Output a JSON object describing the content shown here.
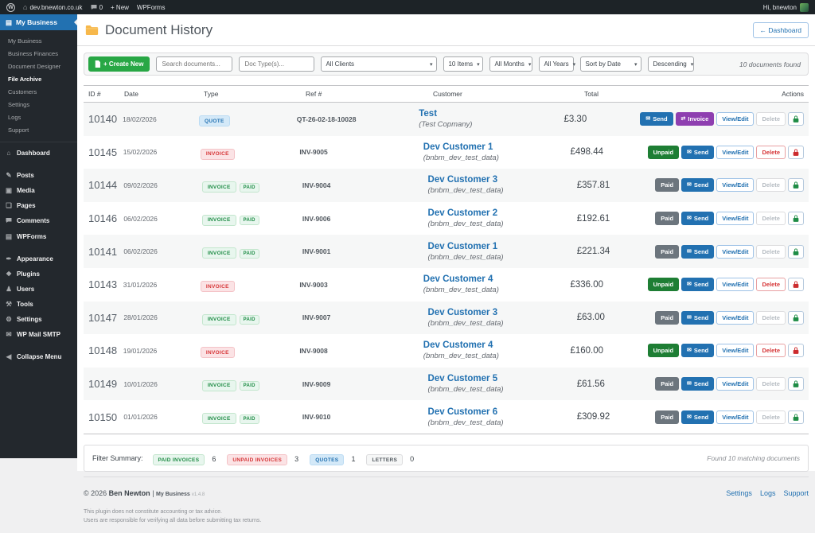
{
  "admin_bar": {
    "site": "dev.bnewton.co.uk",
    "comment_count": "0",
    "new_label": "+ New",
    "wpforms_label": "WPForms",
    "greeting": "Hi, bnewton"
  },
  "sidebar": {
    "top_label": "My Business",
    "submenu": [
      "My Business",
      "Business Finances",
      "Document Designer",
      "File Archive",
      "Customers",
      "Settings",
      "Logs",
      "Support"
    ],
    "active_submenu": "File Archive",
    "menu": [
      {
        "label": "Dashboard",
        "glyph": "⌂",
        "icon": "dashboard-icon",
        "gap": false
      },
      {
        "label": "Posts",
        "glyph": "✎",
        "icon": "posts-icon",
        "gap": true
      },
      {
        "label": "Media",
        "glyph": "▣",
        "icon": "media-icon",
        "gap": false
      },
      {
        "label": "Pages",
        "glyph": "❏",
        "icon": "pages-icon",
        "gap": false
      },
      {
        "label": "Comments",
        "glyph": "bubble",
        "icon": "comments-icon",
        "gap": false
      },
      {
        "label": "WPForms",
        "glyph": "▤",
        "icon": "wpforms-icon",
        "gap": false
      },
      {
        "label": "Appearance",
        "glyph": "✒",
        "icon": "appearance-icon",
        "gap": true
      },
      {
        "label": "Plugins",
        "glyph": "❖",
        "icon": "plugins-icon",
        "gap": false
      },
      {
        "label": "Users",
        "glyph": "♟",
        "icon": "users-icon",
        "gap": false
      },
      {
        "label": "Tools",
        "glyph": "⚒",
        "icon": "tools-icon",
        "gap": false
      },
      {
        "label": "Settings",
        "glyph": "⚙",
        "icon": "settings-icon",
        "gap": false
      },
      {
        "label": "WP Mail SMTP",
        "glyph": "✉",
        "icon": "wp-mail-smtp-icon",
        "gap": false
      },
      {
        "label": "Collapse Menu",
        "glyph": "◀",
        "icon": "collapse-icon",
        "gap": true
      }
    ]
  },
  "header": {
    "title": "Document History",
    "dashboard_button": "← Dashboard"
  },
  "toolbar": {
    "create_label": "+ Create New",
    "search_placeholder": "Search documents...",
    "doctype_placeholder": "Doc Type(s)...",
    "clients_value": "All Clients",
    "items_value": "10 Items",
    "months_value": "All Months",
    "years_value": "All Years",
    "sort_value": "Sort by Date",
    "order_value": "Descending",
    "found_text": "10 documents found"
  },
  "table": {
    "columns": [
      "ID #",
      "Date",
      "Type",
      "Ref #",
      "Customer",
      "Total",
      "Actions"
    ],
    "rows": [
      {
        "id": "10140",
        "date": "18/02/2026",
        "type_badges": [
          {
            "label": "QUOTE",
            "style": "quote"
          }
        ],
        "ref": "QT-26-02-18-10028",
        "customer": "Test",
        "customer_note": "(Test Copmany)",
        "total": "£3.30",
        "actions": [
          {
            "label": "Send",
            "style": "send"
          },
          {
            "label": "Invoice",
            "style": "invoice"
          },
          {
            "label": "View/Edit",
            "style": "view"
          },
          {
            "label": "Delete",
            "style": "delete-disabled"
          },
          {
            "style": "lock",
            "lock_color": "green"
          }
        ]
      },
      {
        "id": "10145",
        "date": "15/02/2026",
        "type_badges": [
          {
            "label": "INVOICE",
            "style": "invoice-red"
          }
        ],
        "ref": "INV-9005",
        "customer": "Dev Customer 1",
        "customer_note": "(bnbm_dev_test_data)",
        "total": "£498.44",
        "actions": [
          {
            "label": "Unpaid",
            "style": "unpaid"
          },
          {
            "label": "Send",
            "style": "send"
          },
          {
            "label": "View/Edit",
            "style": "view"
          },
          {
            "label": "Delete",
            "style": "delete"
          },
          {
            "style": "lock",
            "lock_color": "red"
          }
        ]
      },
      {
        "id": "10144",
        "date": "09/02/2026",
        "type_badges": [
          {
            "label": "INVOICE",
            "style": "invoice-green"
          },
          {
            "label": "PAID",
            "style": "paid-badge"
          }
        ],
        "ref": "INV-9004",
        "customer": "Dev Customer 3",
        "customer_note": "(bnbm_dev_test_data)",
        "total": "£357.81",
        "actions": [
          {
            "label": "Paid",
            "style": "paid"
          },
          {
            "label": "Send",
            "style": "send"
          },
          {
            "label": "View/Edit",
            "style": "view"
          },
          {
            "label": "Delete",
            "style": "delete-disabled"
          },
          {
            "style": "lock",
            "lock_color": "green"
          }
        ]
      },
      {
        "id": "10146",
        "date": "06/02/2026",
        "type_badges": [
          {
            "label": "INVOICE",
            "style": "invoice-green"
          },
          {
            "label": "PAID",
            "style": "paid-badge"
          }
        ],
        "ref": "INV-9006",
        "customer": "Dev Customer 2",
        "customer_note": "(bnbm_dev_test_data)",
        "total": "£192.61",
        "actions": [
          {
            "label": "Paid",
            "style": "paid"
          },
          {
            "label": "Send",
            "style": "send"
          },
          {
            "label": "View/Edit",
            "style": "view"
          },
          {
            "label": "Delete",
            "style": "delete-disabled"
          },
          {
            "style": "lock",
            "lock_color": "green"
          }
        ]
      },
      {
        "id": "10141",
        "date": "06/02/2026",
        "type_badges": [
          {
            "label": "INVOICE",
            "style": "invoice-green"
          },
          {
            "label": "PAID",
            "style": "paid-badge"
          }
        ],
        "ref": "INV-9001",
        "customer": "Dev Customer 1",
        "customer_note": "(bnbm_dev_test_data)",
        "total": "£221.34",
        "actions": [
          {
            "label": "Paid",
            "style": "paid"
          },
          {
            "label": "Send",
            "style": "send"
          },
          {
            "label": "View/Edit",
            "style": "view"
          },
          {
            "label": "Delete",
            "style": "delete-disabled"
          },
          {
            "style": "lock",
            "lock_color": "green"
          }
        ]
      },
      {
        "id": "10143",
        "date": "31/01/2026",
        "type_badges": [
          {
            "label": "INVOICE",
            "style": "invoice-red"
          }
        ],
        "ref": "INV-9003",
        "customer": "Dev Customer 4",
        "customer_note": "(bnbm_dev_test_data)",
        "total": "£336.00",
        "actions": [
          {
            "label": "Unpaid",
            "style": "unpaid"
          },
          {
            "label": "Send",
            "style": "send"
          },
          {
            "label": "View/Edit",
            "style": "view"
          },
          {
            "label": "Delete",
            "style": "delete"
          },
          {
            "style": "lock",
            "lock_color": "red"
          }
        ]
      },
      {
        "id": "10147",
        "date": "28/01/2026",
        "type_badges": [
          {
            "label": "INVOICE",
            "style": "invoice-green"
          },
          {
            "label": "PAID",
            "style": "paid-badge"
          }
        ],
        "ref": "INV-9007",
        "customer": "Dev Customer 3",
        "customer_note": "(bnbm_dev_test_data)",
        "total": "£63.00",
        "actions": [
          {
            "label": "Paid",
            "style": "paid"
          },
          {
            "label": "Send",
            "style": "send"
          },
          {
            "label": "View/Edit",
            "style": "view"
          },
          {
            "label": "Delete",
            "style": "delete-disabled"
          },
          {
            "style": "lock",
            "lock_color": "green"
          }
        ]
      },
      {
        "id": "10148",
        "date": "19/01/2026",
        "type_badges": [
          {
            "label": "INVOICE",
            "style": "invoice-red"
          }
        ],
        "ref": "INV-9008",
        "customer": "Dev Customer 4",
        "customer_note": "(bnbm_dev_test_data)",
        "total": "£160.00",
        "actions": [
          {
            "label": "Unpaid",
            "style": "unpaid"
          },
          {
            "label": "Send",
            "style": "send"
          },
          {
            "label": "View/Edit",
            "style": "view"
          },
          {
            "label": "Delete",
            "style": "delete"
          },
          {
            "style": "lock",
            "lock_color": "red"
          }
        ]
      },
      {
        "id": "10149",
        "date": "10/01/2026",
        "type_badges": [
          {
            "label": "INVOICE",
            "style": "invoice-green"
          },
          {
            "label": "PAID",
            "style": "paid-badge"
          }
        ],
        "ref": "INV-9009",
        "customer": "Dev Customer 5",
        "customer_note": "(bnbm_dev_test_data)",
        "total": "£61.56",
        "actions": [
          {
            "label": "Paid",
            "style": "paid"
          },
          {
            "label": "Send",
            "style": "send"
          },
          {
            "label": "View/Edit",
            "style": "view"
          },
          {
            "label": "Delete",
            "style": "delete-disabled"
          },
          {
            "style": "lock",
            "lock_color": "green"
          }
        ]
      },
      {
        "id": "10150",
        "date": "01/01/2026",
        "type_badges": [
          {
            "label": "INVOICE",
            "style": "invoice-green"
          },
          {
            "label": "PAID",
            "style": "paid-badge"
          }
        ],
        "ref": "INV-9010",
        "customer": "Dev Customer 6",
        "customer_note": "(bnbm_dev_test_data)",
        "total": "£309.92",
        "actions": [
          {
            "label": "Paid",
            "style": "paid"
          },
          {
            "label": "Send",
            "style": "send"
          },
          {
            "label": "View/Edit",
            "style": "view"
          },
          {
            "label": "Delete",
            "style": "delete-disabled"
          },
          {
            "style": "lock",
            "lock_color": "green"
          }
        ]
      }
    ]
  },
  "summary": {
    "label": "Filter Summary:",
    "items": [
      {
        "label": "PAID INVOICES",
        "count": "6",
        "style": "invoice-green"
      },
      {
        "label": "UNPAID INVOICES",
        "count": "3",
        "style": "invoice-red"
      },
      {
        "label": "QUOTES",
        "count": "1",
        "style": "quote"
      },
      {
        "label": "LETTERS",
        "count": "0",
        "style": "letters"
      }
    ],
    "found_text": "Found 10 matching documents"
  },
  "footer": {
    "copyright": "© 2026",
    "author": "Ben Newton",
    "plugin_name": "My Business",
    "version": "v1.4.8",
    "links": [
      "Settings",
      "Logs",
      "Support"
    ],
    "disclaimer_line1": "This plugin does not constitute accounting or tax advice.",
    "disclaimer_line2": "Users are responsible for verifying all data before submitting tax returns."
  },
  "colors": {
    "accent_blue": "#2271b1",
    "green": "#28a745",
    "unpaid_green": "#1e7e34",
    "paid_grey": "#6c757d",
    "invoice_purple": "#8e3fb0",
    "delete_red": "#d63638"
  }
}
